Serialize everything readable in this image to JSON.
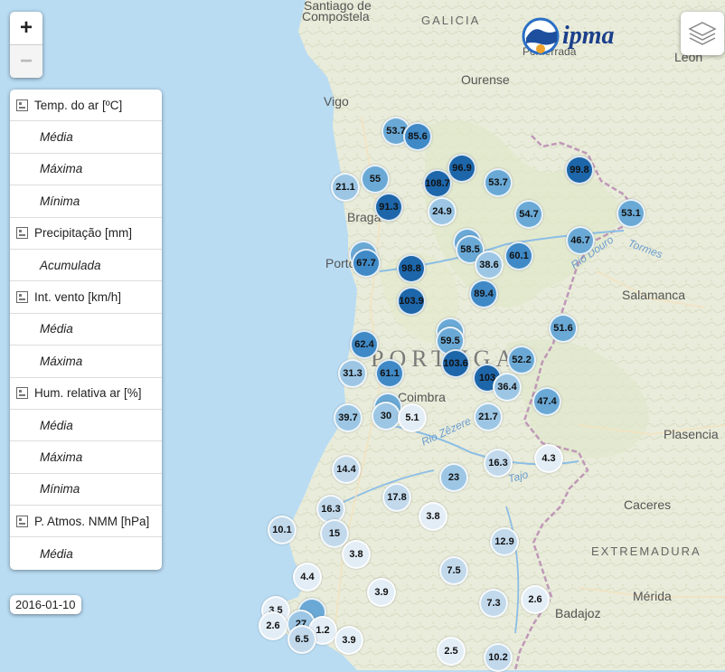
{
  "logo": {
    "text": "ipma"
  },
  "zoom": {
    "in_label": "+",
    "out_label": "−"
  },
  "panel": {
    "groups": [
      {
        "label": "Temp. do ar [ºC]",
        "items": [
          "Média",
          "Máxima",
          "Mínima"
        ]
      },
      {
        "label": "Precipitação [mm]",
        "items": [
          "Acumulada"
        ]
      },
      {
        "label": "Int. vento [km/h]",
        "items": [
          "Média",
          "Máxima"
        ]
      },
      {
        "label": "Hum. relativa ar [%]",
        "items": [
          "Média",
          "Máxima",
          "Mínima"
        ]
      },
      {
        "label": "P. Atmos. NMM [hPa]",
        "items": [
          "Média"
        ]
      }
    ]
  },
  "date": "2016-01-10",
  "places": [
    {
      "name": "Santiago de"
    },
    {
      "name": "Compostela"
    },
    {
      "name": "GALICIA"
    },
    {
      "name": "Ourense"
    },
    {
      "name": "Vigo"
    },
    {
      "name": "Braga"
    },
    {
      "name": "Porto"
    },
    {
      "name": "PORTUGAL"
    },
    {
      "name": "Coimbra"
    },
    {
      "name": "Salamanca"
    },
    {
      "name": "Plasencia"
    },
    {
      "name": "Caceres"
    },
    {
      "name": "EXTREMADURA"
    },
    {
      "name": "Mérida"
    },
    {
      "name": "Badajoz"
    },
    {
      "name": "León"
    },
    {
      "name": "Ponferrada"
    },
    {
      "name": "Rio Douro"
    },
    {
      "name": "Tormes"
    },
    {
      "name": "Rio Zêzere"
    },
    {
      "name": "Tajo"
    }
  ],
  "colors": {
    "sea": "#b9dcf3",
    "land": "#eef0e2",
    "marker_scale": [
      "#e3edf6",
      "#c2d9ec",
      "#9cc6e4",
      "#6aa9d6",
      "#3f89c6",
      "#1d66aa"
    ]
  },
  "markers": [
    {
      "value": "53.7"
    },
    {
      "value": "85.6"
    },
    {
      "value": "96.9"
    },
    {
      "value": "99.8"
    },
    {
      "value": "21.1"
    },
    {
      "value": "55"
    },
    {
      "value": "108.7"
    },
    {
      "value": "53.7"
    },
    {
      "value": "91.3"
    },
    {
      "value": "24.9"
    },
    {
      "value": "54.7"
    },
    {
      "value": "53.1"
    },
    {
      "value": ""
    },
    {
      "value": "67.7"
    },
    {
      "value": ""
    },
    {
      "value": "58.5"
    },
    {
      "value": "60.1"
    },
    {
      "value": "46.7"
    },
    {
      "value": "98.8"
    },
    {
      "value": "38.6"
    },
    {
      "value": "89.4"
    },
    {
      "value": "103.9"
    },
    {
      "value": "51.6"
    },
    {
      "value": ""
    },
    {
      "value": "59.5"
    },
    {
      "value": "62.4"
    },
    {
      "value": "103.6"
    },
    {
      "value": "52.2"
    },
    {
      "value": "31.3"
    },
    {
      "value": "61.1"
    },
    {
      "value": "103"
    },
    {
      "value": "36.4"
    },
    {
      "value": ""
    },
    {
      "value": "47.4"
    },
    {
      "value": "39.7"
    },
    {
      "value": "30"
    },
    {
      "value": "5.1"
    },
    {
      "value": "21.7"
    },
    {
      "value": "4.3"
    },
    {
      "value": "14.4"
    },
    {
      "value": "16.3"
    },
    {
      "value": "23"
    },
    {
      "value": "17.8"
    },
    {
      "value": "16.3"
    },
    {
      "value": "3.8"
    },
    {
      "value": "10.1"
    },
    {
      "value": "15"
    },
    {
      "value": "12.9"
    },
    {
      "value": "3.8"
    },
    {
      "value": "7.5"
    },
    {
      "value": "4.4"
    },
    {
      "value": "3.9"
    },
    {
      "value": "7.3"
    },
    {
      "value": "2.6"
    },
    {
      "value": "3.5"
    },
    {
      "value": ""
    },
    {
      "value": "2.6"
    },
    {
      "value": "27"
    },
    {
      "value": "1.2"
    },
    {
      "value": "6.5"
    },
    {
      "value": "3.9"
    },
    {
      "value": "2.5"
    },
    {
      "value": "10.2"
    }
  ]
}
